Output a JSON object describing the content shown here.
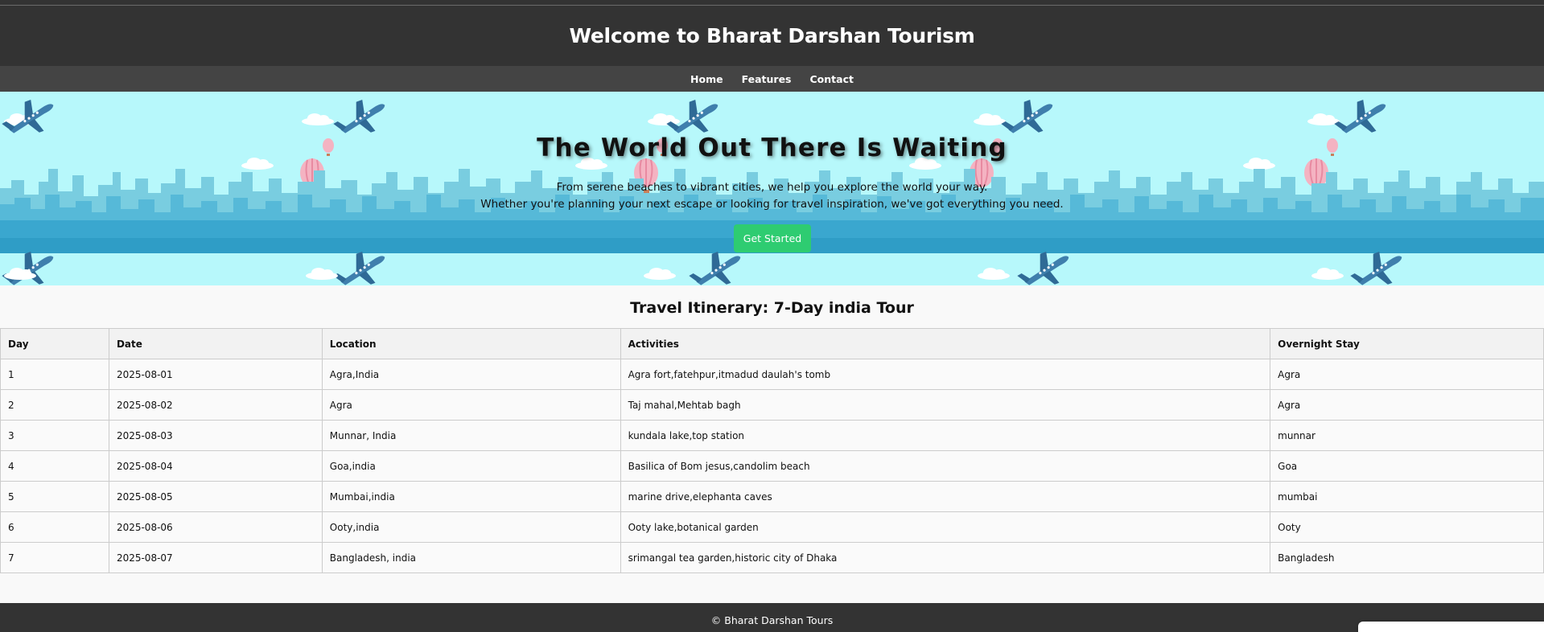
{
  "header": {
    "title": "Welcome to Bharat Darshan Tourism"
  },
  "nav": {
    "items": [
      {
        "label": "Home"
      },
      {
        "label": "Features"
      },
      {
        "label": "Contact"
      }
    ]
  },
  "hero": {
    "title": "The World Out There Is Waiting",
    "line1": "From serene beaches to vibrant cities, we help you explore the world your way.",
    "line2": "Whether you're planning your next escape or looking for travel inspiration, we've got everything you need.",
    "cta_label": "Get Started",
    "sky_color": "#b7f8fb",
    "skyline_color": "#3aa7cf",
    "button_color": "#2ecc71"
  },
  "itinerary": {
    "title": "Travel Itinerary: 7-Day india Tour",
    "columns": [
      "Day",
      "Date",
      "Location",
      "Activities",
      "Overnight Stay"
    ],
    "rows": [
      [
        "1",
        "2025-08-01",
        "Agra,India",
        "Agra fort,fatehpur,itmadud daulah's tomb",
        "Agra"
      ],
      [
        "2",
        "2025-08-02",
        "Agra",
        "Taj mahal,Mehtab bagh",
        "Agra"
      ],
      [
        "3",
        "2025-08-03",
        "Munnar, India",
        "kundala lake,top station",
        "munnar"
      ],
      [
        "4",
        "2025-08-04",
        "Goa,india",
        "Basilica of Bom jesus,candolim beach",
        "Goa"
      ],
      [
        "5",
        "2025-08-05",
        "Mumbai,india",
        "marine drive,elephanta caves",
        "mumbai"
      ],
      [
        "6",
        "2025-08-06",
        "Ooty,india",
        "Ooty lake,botanical garden",
        "Ooty"
      ],
      [
        "7",
        "2025-08-07",
        "Bangladesh, india",
        "srimangal tea garden,historic city of Dhaka",
        "Bangladesh"
      ]
    ]
  },
  "footer": {
    "text": "© Bharat Darshan Tours"
  }
}
